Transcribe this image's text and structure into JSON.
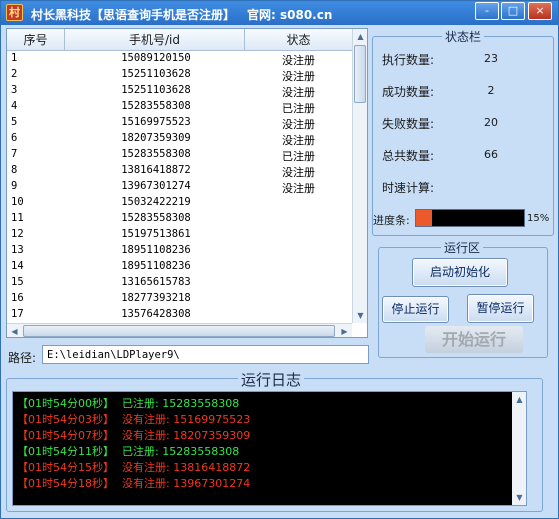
{
  "window": {
    "icon_char": "村",
    "title": "村长黑科技【思语查询手机是否注册】",
    "site": "官网: s080.cn",
    "minimize": "-",
    "maximize": "□",
    "close": "×"
  },
  "table": {
    "columns": [
      "序号",
      "手机号/id",
      "状态"
    ],
    "rows": [
      {
        "idx": "1",
        "phone": "15089120150",
        "status": "没注册"
      },
      {
        "idx": "2",
        "phone": "15251103628",
        "status": "没注册"
      },
      {
        "idx": "3",
        "phone": "15251103628",
        "status": "没注册"
      },
      {
        "idx": "4",
        "phone": "15283558308",
        "status": "已注册"
      },
      {
        "idx": "5",
        "phone": "15169975523",
        "status": "没注册"
      },
      {
        "idx": "6",
        "phone": "18207359309",
        "status": "没注册"
      },
      {
        "idx": "7",
        "phone": "15283558308",
        "status": "已注册"
      },
      {
        "idx": "8",
        "phone": "13816418872",
        "status": "没注册"
      },
      {
        "idx": "9",
        "phone": "13967301274",
        "status": "没注册"
      },
      {
        "idx": "10",
        "phone": "15032422219",
        "status": ""
      },
      {
        "idx": "11",
        "phone": "15283558308",
        "status": ""
      },
      {
        "idx": "12",
        "phone": "15197513861",
        "status": ""
      },
      {
        "idx": "13",
        "phone": "18951108236",
        "status": ""
      },
      {
        "idx": "14",
        "phone": "18951108236",
        "status": ""
      },
      {
        "idx": "15",
        "phone": "13165615783",
        "status": ""
      },
      {
        "idx": "16",
        "phone": "18277393218",
        "status": ""
      },
      {
        "idx": "17",
        "phone": "13576428308",
        "status": ""
      }
    ]
  },
  "status_panel": {
    "title": "状态栏",
    "executed_label": "执行数量:",
    "executed_value": "23",
    "success_label": "成功数量:",
    "success_value": "2",
    "fail_label": "失败数量:",
    "fail_value": "20",
    "total_label": "总共数量:",
    "total_value": "66",
    "speed_label": "时速计算:",
    "speed_value": "",
    "progress_label": "进度条:",
    "progress_text": "15%",
    "progress_percent": 15
  },
  "run_panel": {
    "title": "运行区",
    "init_button": "启动初始化",
    "stop_button": "停止运行",
    "pause_button": "暂停运行",
    "start_button": "开始运行"
  },
  "path": {
    "label": "路径:",
    "value": "E:\\leidian\\LDPlayer9\\"
  },
  "log": {
    "title": "运行日志",
    "lines": [
      {
        "time": "【01时54分00秒】",
        "msg": "已注册: 15283558308",
        "time_color": "#37e34a",
        "msg_color": "#37e34a"
      },
      {
        "time": "【01时54分03秒】",
        "msg": "没有注册: 15169975523",
        "time_color": "#f2371f",
        "msg_color": "#f2371f"
      },
      {
        "time": "【01时54分07秒】",
        "msg": "没有注册: 18207359309",
        "time_color": "#f2371f",
        "msg_color": "#f2371f"
      },
      {
        "time": "【01时54分11秒】",
        "msg": "已注册: 15283558308",
        "time_color": "#37e34a",
        "msg_color": "#37e34a"
      },
      {
        "time": "【01时54分15秒】",
        "msg": "没有注册: 13816418872",
        "time_color": "#f2371f",
        "msg_color": "#f2371f"
      },
      {
        "time": "【01时54分18秒】",
        "msg": "没有注册: 13967301274",
        "time_color": "#f2371f",
        "msg_color": "#f2371f"
      }
    ]
  }
}
